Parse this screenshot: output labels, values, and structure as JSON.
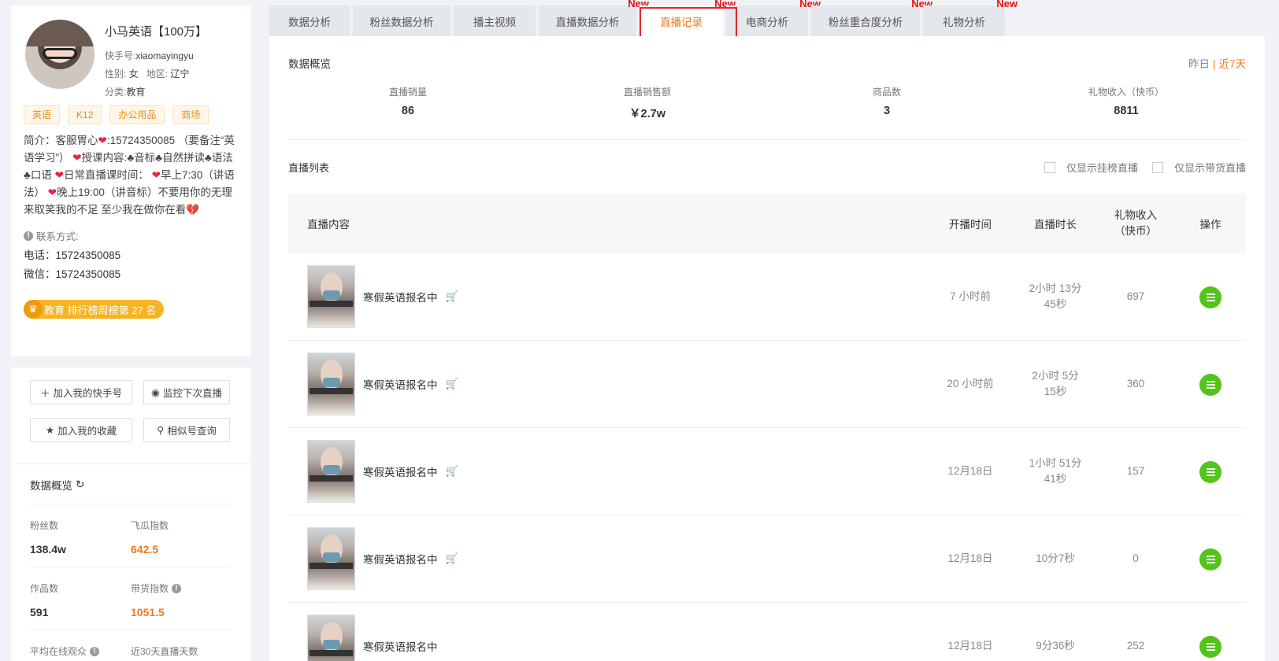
{
  "profile": {
    "name": "小马英语【100万】",
    "kuaishou_id_label": "快手号:",
    "kuaishou_id": "xiaomayingyu",
    "gender_label": "性别:",
    "gender": "女",
    "region_label": "地区:",
    "region": "辽宁",
    "category_label": "分类:",
    "category": "教育",
    "tags": [
      "英语",
      "K12",
      "办公用品",
      "商场"
    ],
    "bio_parts": [
      "简介：客服胃心",
      ":15724350085 （要备注“英语学习”） ",
      "授课内容:♣音标♣自然拼读♣语法♣口语 ",
      "日常直播课时间： ",
      "早上7:30（讲语法） ",
      "晚上19:00（讲音标）不要用你的无理来取笑我的不足 至少我在做你在看"
    ],
    "contact_label": "联系方式:",
    "phone_label": "电话：",
    "phone": "15724350085",
    "wechat_label": "微信：",
    "wechat": "15724350085",
    "rank_text": "教育 排行榜周榜第 27 名"
  },
  "actions": {
    "add_kuaishou": "加入我的快手号",
    "monitor_live": "监控下次直播",
    "add_favorite": "加入我的收藏",
    "similar_query": "相似号查询"
  },
  "overview_left": {
    "title": "数据概览",
    "fans_label": "粉丝数",
    "fans": "138.4w",
    "feigua_label": "飞瓜指数",
    "feigua": "642.5",
    "works_label": "作品数",
    "works": "591",
    "sales_index_label": "带货指数",
    "sales_index": "1051.5",
    "avg_online_label": "平均在线观众",
    "live_days_label": "近30天直播天数"
  },
  "tabs": [
    {
      "label": "数据分析",
      "new": ""
    },
    {
      "label": "粉丝数据分析",
      "new": ""
    },
    {
      "label": "播主视频",
      "new": ""
    },
    {
      "label": "直播数据分析",
      "new": "New"
    },
    {
      "label": "直播记录",
      "new": "New"
    },
    {
      "label": "电商分析",
      "new": "New"
    },
    {
      "label": "粉丝重合度分析",
      "new": "New"
    },
    {
      "label": "礼物分析",
      "new": "New"
    }
  ],
  "overview": {
    "title": "数据概览",
    "yesterday": "昨日",
    "sep": "|",
    "last7": "近7天",
    "stats": [
      {
        "label": "直播销量",
        "value": "86"
      },
      {
        "label": "直播销售额",
        "value": "￥2.7w"
      },
      {
        "label": "商品数",
        "value": "3"
      },
      {
        "label": "礼物收入（快币）",
        "value": "8811"
      }
    ]
  },
  "live_list": {
    "title": "直播列表",
    "filter1": "仅显示挂榜直播",
    "filter2": "仅显示带货直播",
    "headers": {
      "content": "直播内容",
      "start": "开播时间",
      "duration": "直播时长",
      "gift1": "礼物收入",
      "gift2": "（快币）",
      "op": "操作"
    },
    "rows": [
      {
        "title": "寒假英语报名中",
        "start": "7 小时前",
        "dur1": "2小时 13分",
        "dur2": "45秒",
        "gift": "697",
        "cart": "🛒"
      },
      {
        "title": "寒假英语报名中",
        "start": "20 小时前",
        "dur1": "2小时 5分",
        "dur2": "15秒",
        "gift": "360",
        "cart": "🛒"
      },
      {
        "title": "寒假英语报名中",
        "start": "12月18日",
        "dur1": "1小时 51分",
        "dur2": "41秒",
        "gift": "157",
        "cart": "🛒"
      },
      {
        "title": "寒假英语报名中",
        "start": "12月18日",
        "dur1": "10分7秒",
        "dur2": "",
        "gift": "0",
        "cart": "🛒"
      },
      {
        "title": "寒假英语报名中",
        "start": "12月18日",
        "dur1": "9分36秒",
        "dur2": "",
        "gift": "252",
        "cart": ""
      }
    ]
  }
}
